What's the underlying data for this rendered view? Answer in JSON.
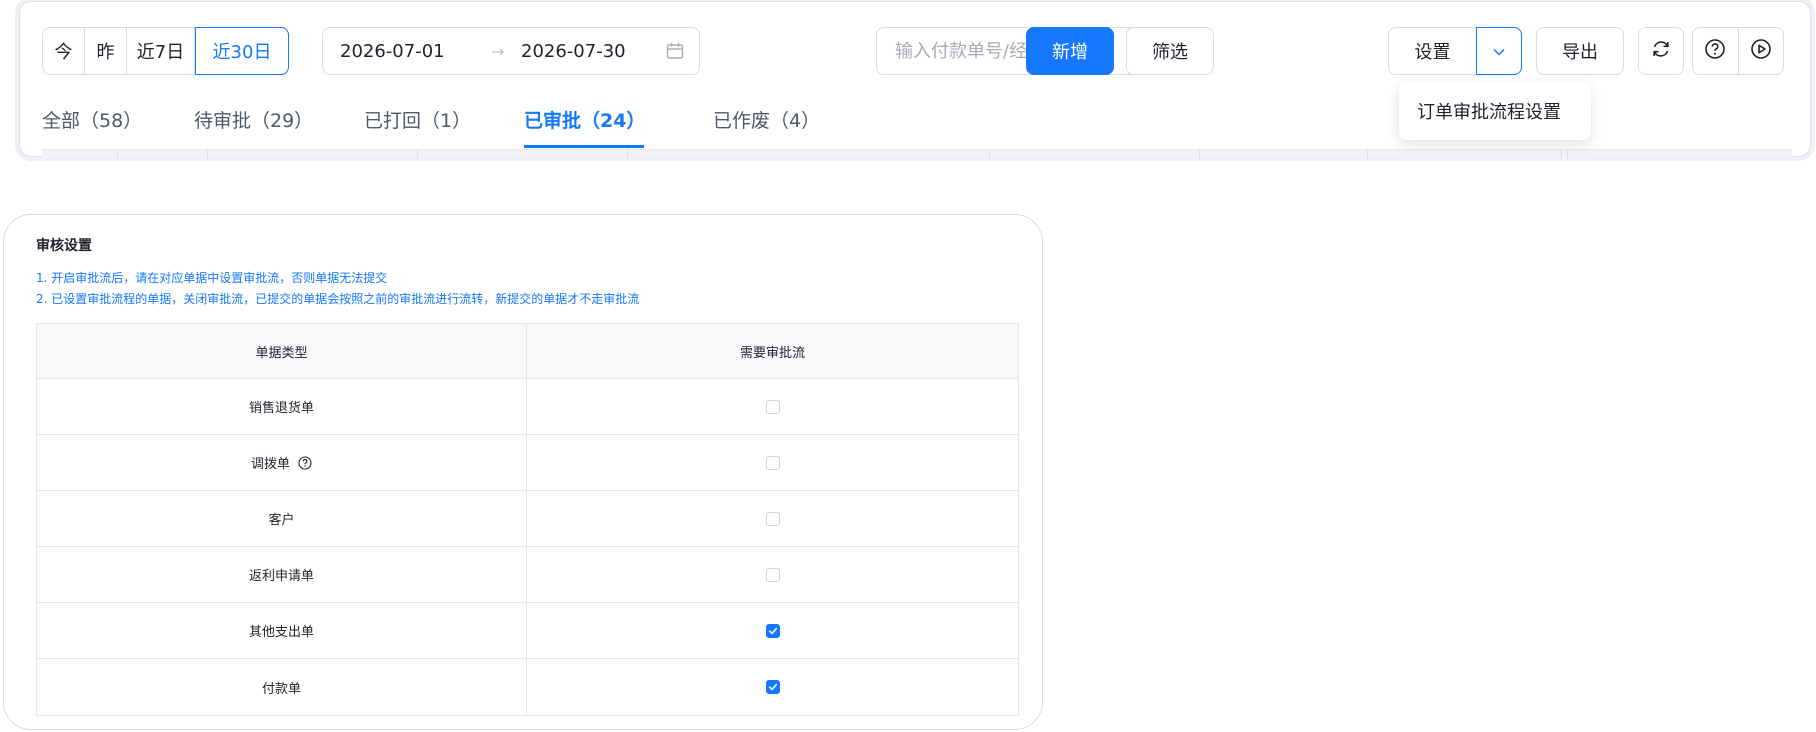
{
  "toolbar": {
    "quick_dates": [
      "今",
      "昨",
      "近7日",
      "近30日"
    ],
    "quick_date_active": "近30日",
    "date_start": "2026-07-01",
    "date_arrow": "→",
    "date_end": "2026-07-30",
    "search_placeholder": "输入付款单号/经办人...",
    "new_label": "新增",
    "filter_label": "筛选",
    "settings_label": "设置",
    "export_label": "导出",
    "dropdown_item": "订单审批流程设置"
  },
  "tabs": [
    {
      "label": "全部（58）",
      "active": false
    },
    {
      "label": "待审批（29）",
      "active": false
    },
    {
      "label": "已打回（1）",
      "active": false
    },
    {
      "label": "已审批（24）",
      "active": true
    },
    {
      "label": "已作废（4）",
      "active": false
    }
  ],
  "audit": {
    "title": "审核设置",
    "note1": "1. 开启审批流后，请在对应单据中设置审批流，否则单据无法提交",
    "note2": "2. 已设置审批流程的单据，关闭审批流，已提交的单据会按照之前的审批流进行流转，新提交的单据才不走审批流",
    "col_doc_type": "单据类型",
    "col_need_flow": "需要审批流",
    "rows": [
      {
        "name": "销售退货单",
        "checked": false
      },
      {
        "name": "调拨单",
        "checked": false
      },
      {
        "name": "客户",
        "checked": false
      },
      {
        "name": "返利申请单",
        "checked": false
      },
      {
        "name": "其他支出单",
        "checked": true
      },
      {
        "name": "付款单",
        "checked": true
      }
    ]
  },
  "colors": {
    "accent": "#1677ff",
    "border": "#d9dce1",
    "text": "#1f2329"
  }
}
